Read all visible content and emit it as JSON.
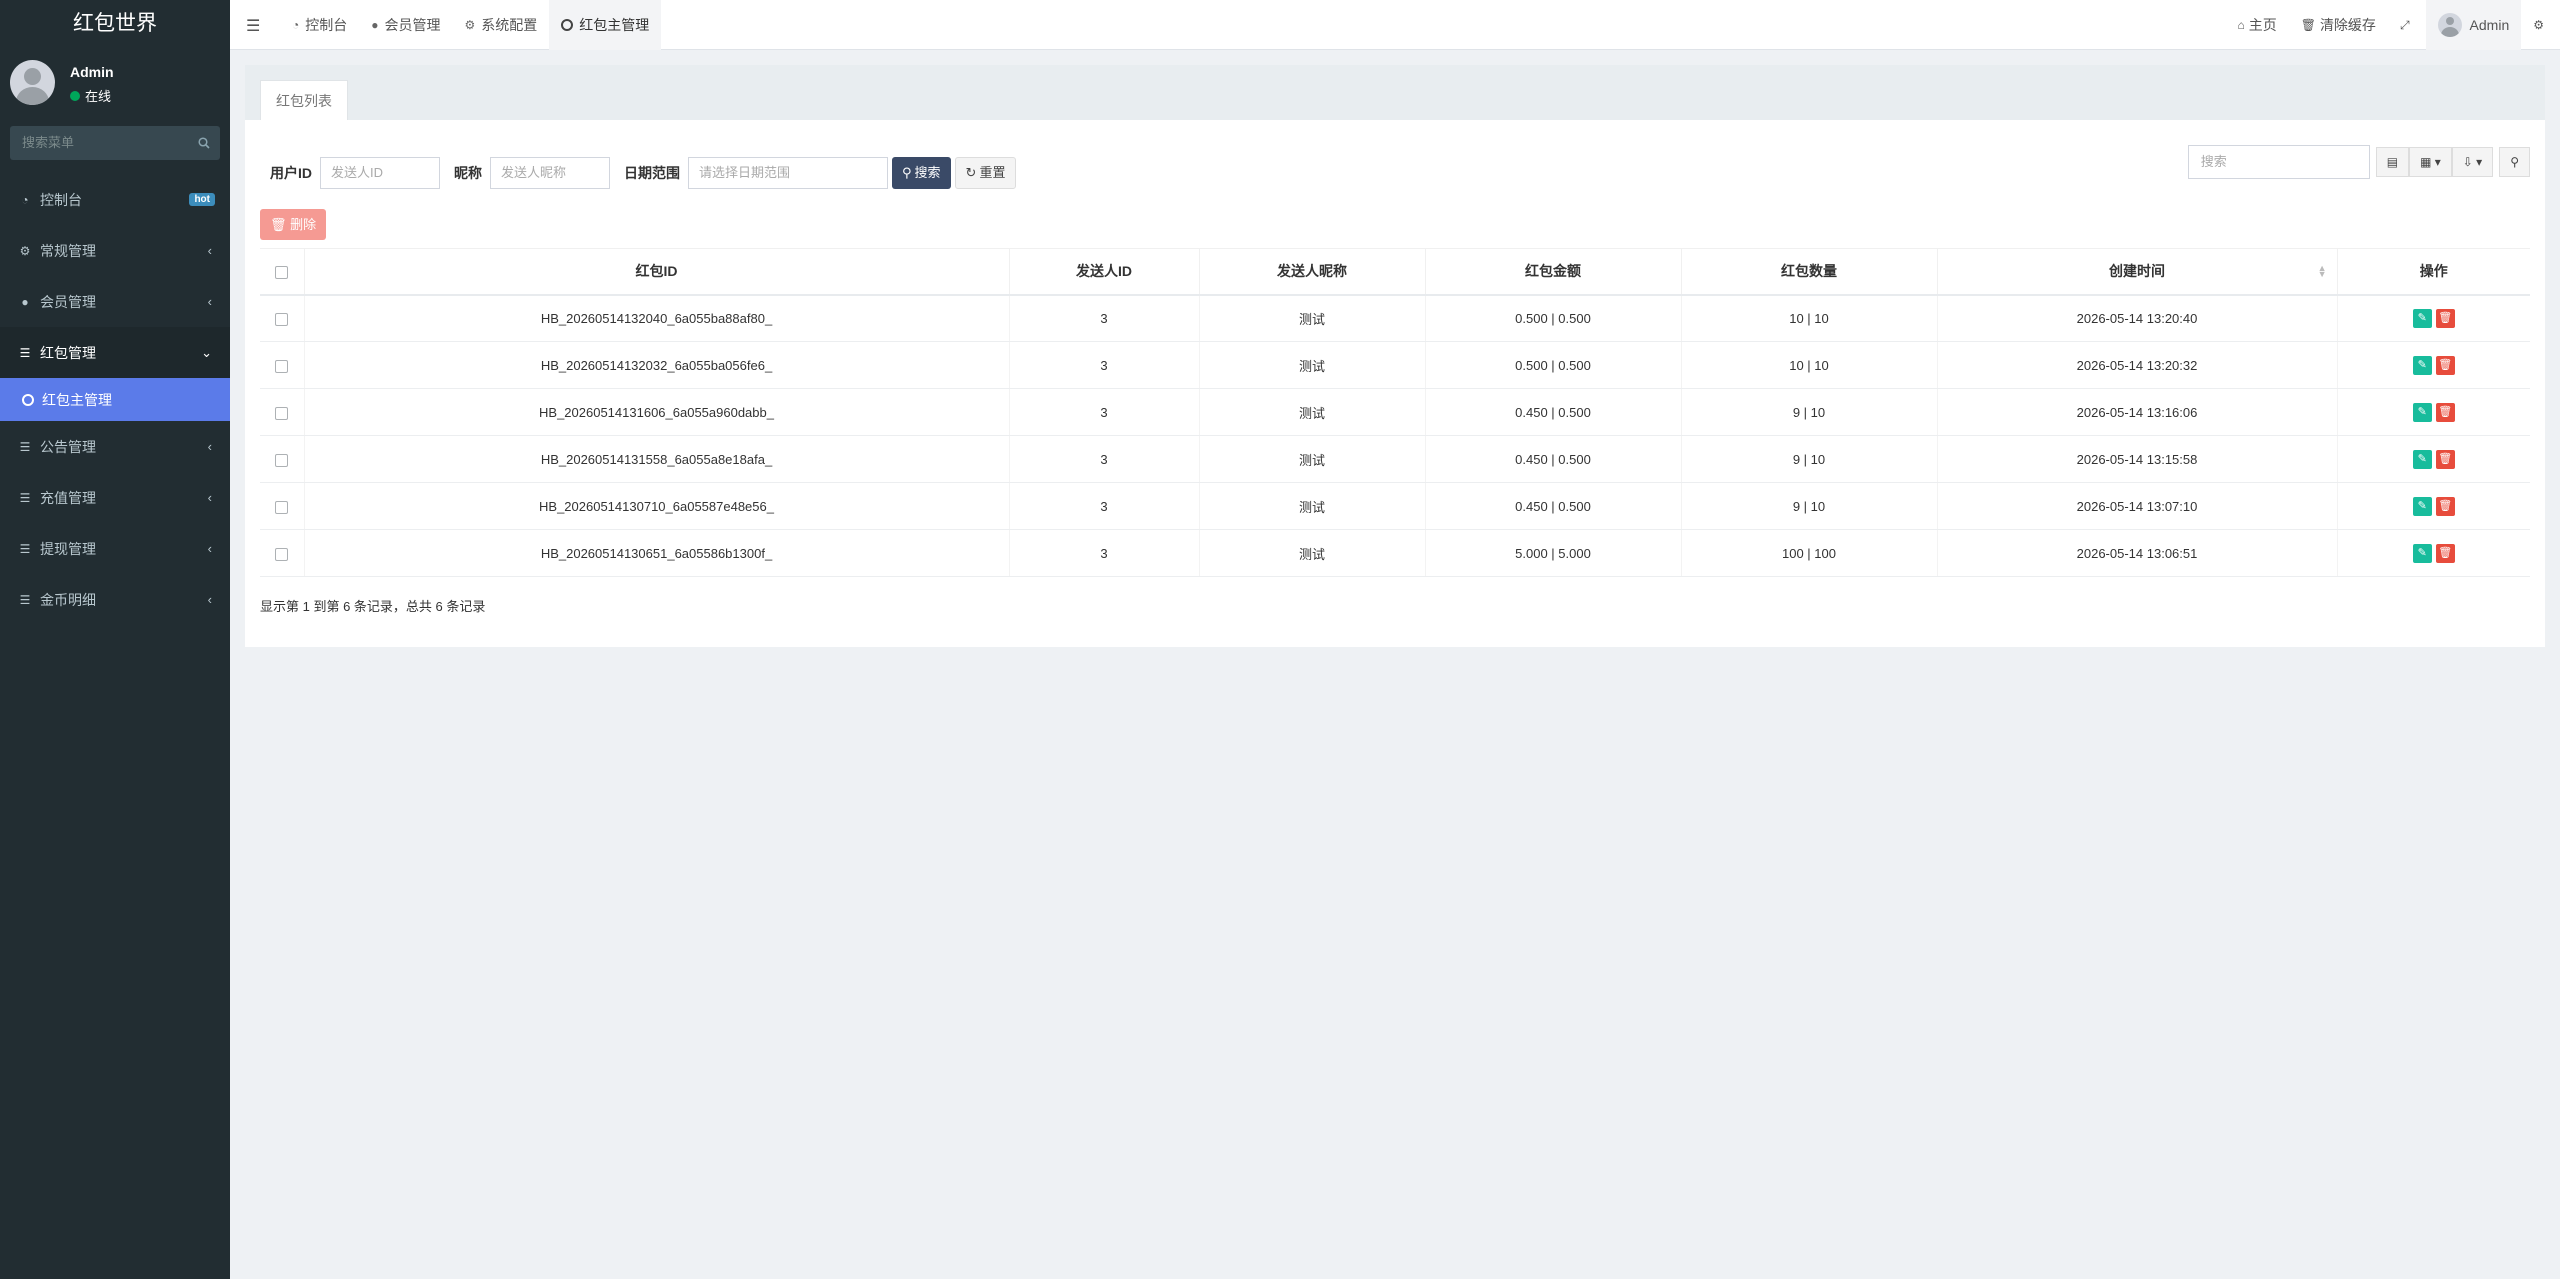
{
  "sidebar": {
    "logo": "红包世界",
    "user": {
      "name": "Admin",
      "status": "在线"
    },
    "search_placeholder": "搜索菜单",
    "items": [
      {
        "label": "控制台",
        "icon": "dashboard-icon",
        "badge": "hot"
      },
      {
        "label": "常规管理",
        "icon": "cogs-icon"
      },
      {
        "label": "会员管理",
        "icon": "user-circle-icon"
      },
      {
        "label": "红包管理",
        "icon": "list-icon",
        "expanded": true
      },
      {
        "label": "公告管理",
        "icon": "list-icon"
      },
      {
        "label": "充值管理",
        "icon": "list-icon"
      },
      {
        "label": "提现管理",
        "icon": "list-icon"
      },
      {
        "label": "金币明细",
        "icon": "list-icon"
      }
    ],
    "sub_item": "红包主管理"
  },
  "topbar": {
    "tabs": [
      {
        "label": "控制台",
        "icon": "dashboard-icon"
      },
      {
        "label": "会员管理",
        "icon": "user-icon"
      },
      {
        "label": "系统配置",
        "icon": "gear-icon"
      },
      {
        "label": "红包主管理",
        "icon": "circle-icon"
      }
    ],
    "home": "主页",
    "clear_cache": "清除缓存",
    "user": "Admin"
  },
  "panel": {
    "tab": "红包列表",
    "filter": {
      "user_id_label": "用户ID",
      "user_id_placeholder": "发送人ID",
      "nickname_label": "昵称",
      "nickname_placeholder": "发送人昵称",
      "date_label": "日期范围",
      "date_placeholder": "请选择日期范围",
      "search_btn": "搜索",
      "reset_btn": "重置"
    },
    "search_placeholder": "搜索",
    "delete_btn": "删除",
    "table": {
      "headers": [
        "红包ID",
        "发送人ID",
        "发送人昵称",
        "红包金额",
        "红包数量",
        "创建时间",
        "操作"
      ],
      "rows": [
        [
          "HB_20260514132040_6a055ba88af80_",
          "3",
          "测试",
          "0.500 | 0.500",
          "10 | 10",
          "2026-05-14 13:20:40"
        ],
        [
          "HB_20260514132032_6a055ba056fe6_",
          "3",
          "测试",
          "0.500 | 0.500",
          "10 | 10",
          "2026-05-14 13:20:32"
        ],
        [
          "HB_20260514131606_6a055a960dabb_",
          "3",
          "测试",
          "0.450 | 0.500",
          "9 | 10",
          "2026-05-14 13:16:06"
        ],
        [
          "HB_20260514131558_6a055a8e18afa_",
          "3",
          "测试",
          "0.450 | 0.500",
          "9 | 10",
          "2026-05-14 13:15:58"
        ],
        [
          "HB_20260514130710_6a05587e48e56_",
          "3",
          "测试",
          "0.450 | 0.500",
          "9 | 10",
          "2026-05-14 13:07:10"
        ],
        [
          "HB_20260514130651_6a05586b1300f_",
          "3",
          "测试",
          "5.000 | 5.000",
          "100 | 100",
          "2026-05-14 13:06:51"
        ]
      ]
    },
    "footer": "显示第 1 到第 6 条记录，总共 6 条记录"
  },
  "colors": {
    "sidebar_bg": "#222d32",
    "active_sub": "#5b7be9",
    "edit": "#18bc9c",
    "delete": "#e74c3c",
    "search_btn": "#3a4a67"
  }
}
